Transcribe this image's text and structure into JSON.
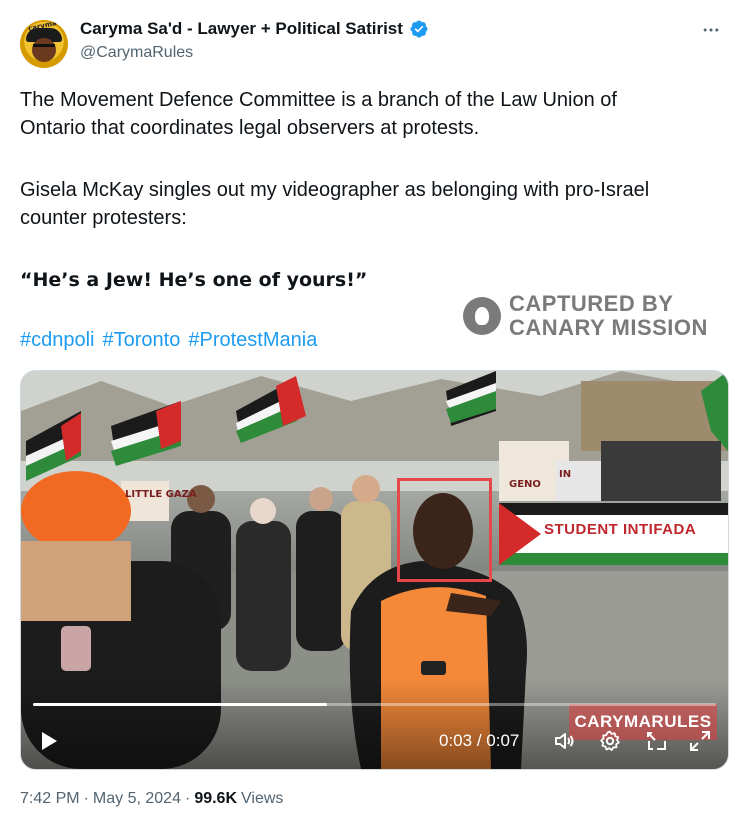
{
  "author": {
    "display_name": "Caryma Sa'd - Lawyer + Political Satirist",
    "handle": "@CarymaRules",
    "verified": true,
    "avatar_icon": "avatar-caricature",
    "avatar_text": "caryma"
  },
  "more_icon": "more-horizontal-icon",
  "tweet": {
    "paragraph_1": "The Movement Defence Committee is a branch of the Law Union of\nOntario that coordinates legal observers at protests.",
    "paragraph_2": "Gisela McKay singles out my videographer as belonging with pro-Israel\ncounter protesters:",
    "quote": "“He’s a Jew! He’s one of yours!”",
    "hashtags": [
      "#cdnpoli",
      "#Toronto",
      "#ProtestMania"
    ]
  },
  "stamp": {
    "line_1": "CAPTURED BY",
    "line_2": "CANARY MISSION",
    "logo_icon": "canary-logo-icon"
  },
  "video": {
    "banner_text": "STUDENT INTIFADA",
    "sign_1": "LITTLE GAZA",
    "sign_2": "GENO",
    "sign_3": "IN",
    "watermark_text": "CARYMARULES",
    "current_time": "0:03",
    "separator": "/",
    "duration": "0:07",
    "progress": 0.43
  },
  "colors": {
    "link": "#1d9bf0",
    "secondary_text": "#536471",
    "verified_badge": "#1d9bf0",
    "highlight_box": "#e54848"
  },
  "meta": {
    "time": "7:42 PM",
    "dot_1": "·",
    "date": "May 5, 2024",
    "dot_2": "·",
    "views_count": "99.6K",
    "views_label": "Views"
  }
}
